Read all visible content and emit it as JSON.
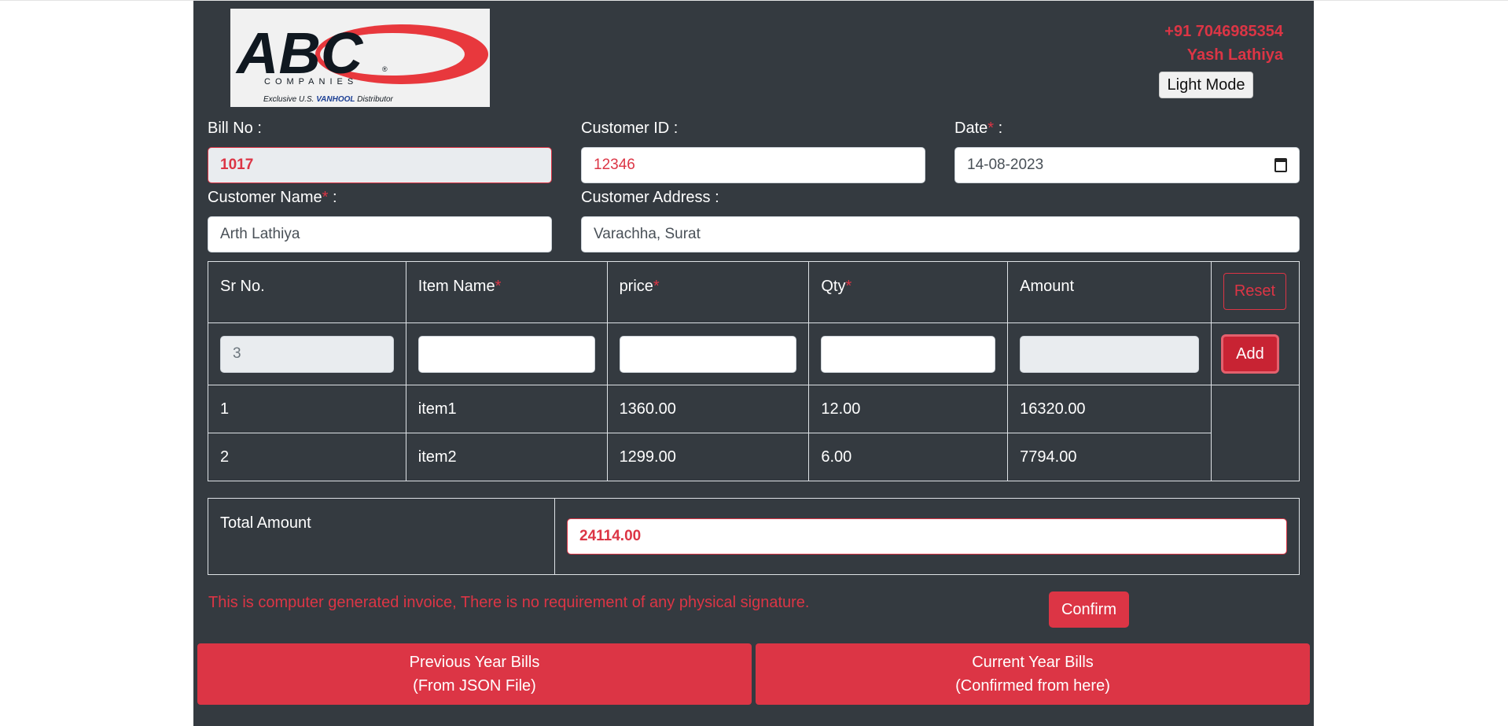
{
  "header": {
    "phone": "+91 7046985354",
    "owner": "Yash Lathiya",
    "mode_button": "Light Mode",
    "logo": {
      "brand": "ABC",
      "sub": "COMPANIES",
      "tagline_prefix": "Exclusive U.S.",
      "tagline_brand": "VANHOOL",
      "tagline_suffix": "Distributor",
      "mark": "®"
    }
  },
  "form": {
    "bill_no": {
      "label": "Bill No :",
      "value": "1017"
    },
    "customer_id": {
      "label": "Customer ID :",
      "value": "12346"
    },
    "date": {
      "label": "Date",
      "req": "*",
      "suffix": " :",
      "value": "14-08-2023"
    },
    "customer_name": {
      "label": "Customer Name",
      "req": "*",
      "suffix": " :",
      "value": "Arth Lathiya"
    },
    "customer_address": {
      "label": "Customer Address :",
      "value": "Varachha, Surat"
    }
  },
  "table": {
    "headers": {
      "sr": "Sr No.",
      "item": "Item Name",
      "price": "price",
      "qty": "Qty",
      "amount": "Amount",
      "req": "*"
    },
    "reset_label": "Reset",
    "add_label": "Add",
    "entry": {
      "sr": "3",
      "item": "",
      "price": "",
      "qty": "",
      "amount": ""
    },
    "rows": [
      {
        "sr": "1",
        "item": "item1",
        "price": "1360.00",
        "qty": "12.00",
        "amount": "16320.00"
      },
      {
        "sr": "2",
        "item": "item2",
        "price": "1299.00",
        "qty": "6.00",
        "amount": "7794.00"
      }
    ]
  },
  "total": {
    "label": "Total Amount",
    "value": "24114.00"
  },
  "footer": {
    "note": "This is computer generated invoice, There is no requirement of any physical signature.",
    "confirm": "Confirm",
    "prev_line1": "Previous Year Bills",
    "prev_line2": "(From JSON File)",
    "curr_line1": "Current Year Bills",
    "curr_line2": "(Confirmed from here)"
  },
  "colors": {
    "accent": "#dc3545",
    "panel": "#343a40",
    "border": "#dee2e6"
  }
}
